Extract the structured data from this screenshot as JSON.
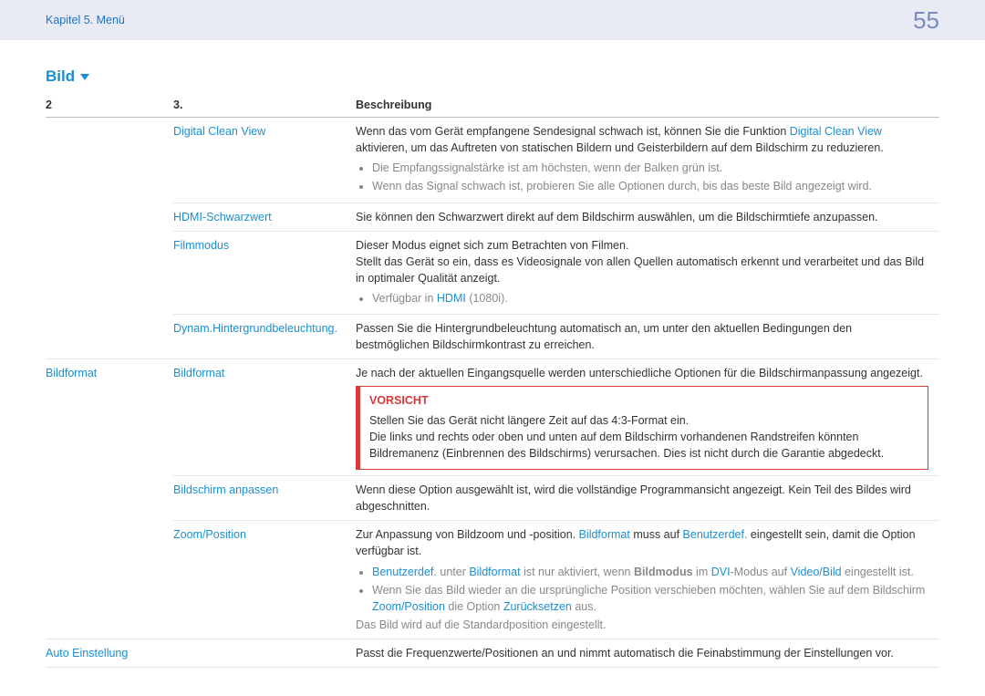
{
  "header": {
    "breadcrumb": "Kapitel 5. Menü",
    "page_number": "55"
  },
  "section_title": "Bild",
  "columns": {
    "col2": "2",
    "col3": "3.",
    "desc": "Beschreibung"
  },
  "rows": {
    "dcv": {
      "l3": "Digital Clean View",
      "pre": "Wenn das vom Gerät empfangene Sendesignal schwach ist, können Sie die Funktion ",
      "link": "Digital Clean View",
      "post": " aktivieren, um das Auftreten von statischen Bildern und Geisterbildern auf dem Bildschirm zu reduzieren.",
      "b1": "Die Empfangssignalstärke ist am höchsten, wenn der Balken grün ist.",
      "b2": "Wenn das Signal schwach ist, probieren Sie alle Optionen durch, bis das beste Bild angezeigt wird."
    },
    "hdmi_black": {
      "l3": "HDMI-Schwarzwert",
      "desc": "Sie können den Schwarzwert direkt auf dem Bildschirm auswählen, um die Bildschirmtiefe anzupassen."
    },
    "film": {
      "l3": "Filmmodus",
      "d1": "Dieser Modus eignet sich zum Betrachten von Filmen.",
      "d2": "Stellt das Gerät so ein, dass es Videosignale von allen Quellen automatisch erkennt und verarbeitet und das Bild in optimaler Qualität anzeigt.",
      "b1_pre": "Verfügbar in ",
      "b1_link": "HDMI",
      "b1_post": " (1080i)."
    },
    "dyn": {
      "l3": "Dynam.Hintergrundbeleuchtung.",
      "desc": "Passen Sie die Hintergrundbeleuchtung automatisch an, um unter den aktuellen Bedingungen den bestmöglichen Bildschirmkontrast zu erreichen."
    },
    "bildformat": {
      "l2": "Bildformat",
      "l3": "Bildformat",
      "desc": "Je nach der aktuellen Eingangsquelle werden unterschiedliche Optionen für die Bildschirmanpassung angezeigt.",
      "caution_title": "VORSICHT",
      "caution_p1": "Stellen Sie das Gerät nicht längere Zeit auf das 4:3-Format ein.",
      "caution_p2": "Die links und rechts oder oben und unten auf dem Bildschirm vorhandenen Randstreifen könnten Bildremanenz (Einbrennen des Bildschirms) verursachen. Dies ist nicht durch die Garantie abgedeckt."
    },
    "fit": {
      "l3": "Bildschirm anpassen",
      "desc": "Wenn diese Option ausgewählt ist, wird die vollständige Programmansicht angezeigt. Kein Teil des Bildes wird abgeschnitten."
    },
    "zoom": {
      "l3": "Zoom/Position",
      "p1_pre": "Zur Anpassung von Bildzoom und -position. ",
      "p1_bf": "Bildformat",
      "p1_mid": " muss auf ",
      "p1_ben": "Benutzerdef.",
      "p1_post": " eingestellt sein, damit die Option verfügbar ist.",
      "b1_ben": "Benutzerdef.",
      "b1_t1": " unter ",
      "b1_bf": "Bildformat",
      "b1_t2": " ist nur aktiviert, wenn ",
      "b1_bm": "Bildmodus",
      "b1_t3": " im ",
      "b1_dvi": "DVI",
      "b1_t4": "-Modus auf ",
      "b1_vb": "Video/Bild",
      "b1_t5": " eingestellt ist.",
      "b2_pre": "Wenn Sie das Bild wieder an die ursprüngliche Position verschieben möchten, wählen Sie auf dem Bildschirm ",
      "b2_zp": "Zoom/Position",
      "b2_mid": " die Option ",
      "b2_rs": "Zurücksetzen",
      "b2_post": " aus.",
      "note": "Das Bild wird auf die Standardposition eingestellt."
    },
    "auto": {
      "l2": "Auto Einstellung",
      "desc": "Passt die Frequenzwerte/Positionen an und nimmt automatisch die Feinabstimmung der Einstellungen vor."
    }
  }
}
